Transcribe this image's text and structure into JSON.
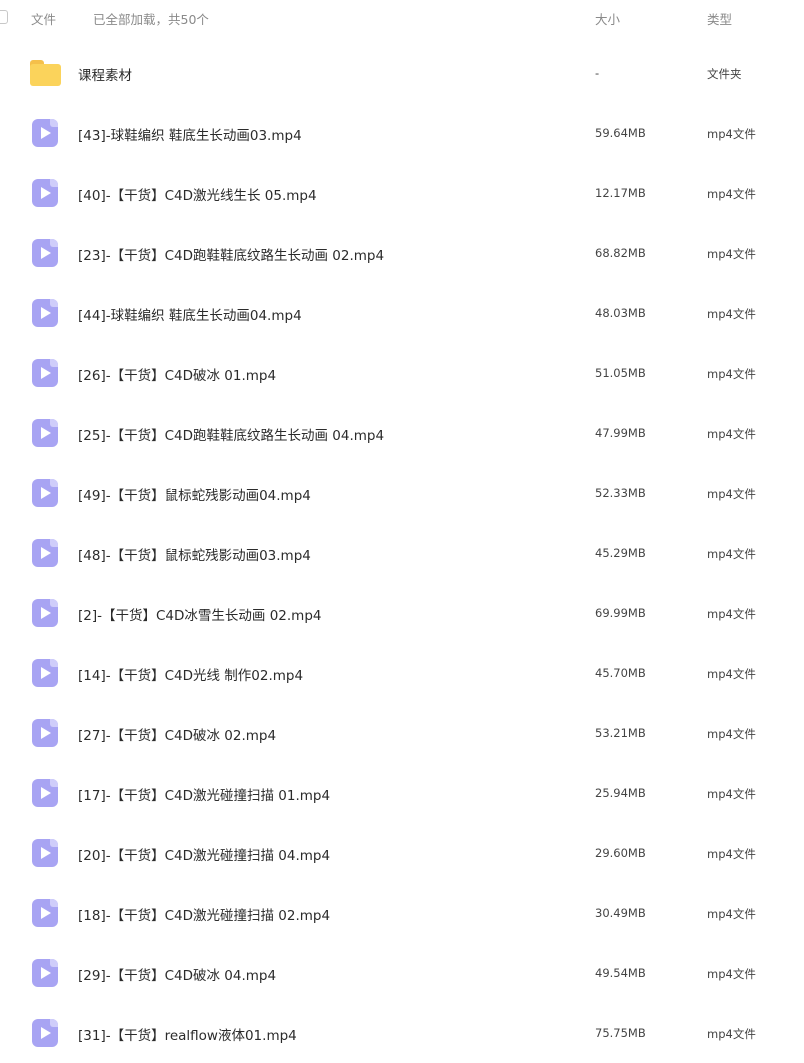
{
  "header": {
    "col_file": "文件",
    "status": "已全部加载，共50个",
    "col_size": "大小",
    "col_type": "类型"
  },
  "files": [
    {
      "name": "课程素材",
      "size": "-",
      "type": "文件夹",
      "icon": "folder-icon"
    },
    {
      "name": "[43]-球鞋编织 鞋底生长动画03.mp4",
      "size": "59.64MB",
      "type": "mp4文件",
      "icon": "video-file-icon"
    },
    {
      "name": "[40]-【干货】C4D激光线生长 05.mp4",
      "size": "12.17MB",
      "type": "mp4文件",
      "icon": "video-file-icon"
    },
    {
      "name": "[23]-【干货】C4D跑鞋鞋底纹路生长动画 02.mp4",
      "size": "68.82MB",
      "type": "mp4文件",
      "icon": "video-file-icon"
    },
    {
      "name": "[44]-球鞋编织 鞋底生长动画04.mp4",
      "size": "48.03MB",
      "type": "mp4文件",
      "icon": "video-file-icon"
    },
    {
      "name": "[26]-【干货】C4D破冰 01.mp4",
      "size": "51.05MB",
      "type": "mp4文件",
      "icon": "video-file-icon"
    },
    {
      "name": "[25]-【干货】C4D跑鞋鞋底纹路生长动画 04.mp4",
      "size": "47.99MB",
      "type": "mp4文件",
      "icon": "video-file-icon"
    },
    {
      "name": "[49]-【干货】鼠标蛇残影动画04.mp4",
      "size": "52.33MB",
      "type": "mp4文件",
      "icon": "video-file-icon"
    },
    {
      "name": "[48]-【干货】鼠标蛇残影动画03.mp4",
      "size": "45.29MB",
      "type": "mp4文件",
      "icon": "video-file-icon"
    },
    {
      "name": "[2]-【干货】C4D冰雪生长动画 02.mp4",
      "size": "69.99MB",
      "type": "mp4文件",
      "icon": "video-file-icon"
    },
    {
      "name": "[14]-【干货】C4D光线 制作02.mp4",
      "size": "45.70MB",
      "type": "mp4文件",
      "icon": "video-file-icon"
    },
    {
      "name": "[27]-【干货】C4D破冰 02.mp4",
      "size": "53.21MB",
      "type": "mp4文件",
      "icon": "video-file-icon"
    },
    {
      "name": "[17]-【干货】C4D激光碰撞扫描 01.mp4",
      "size": "25.94MB",
      "type": "mp4文件",
      "icon": "video-file-icon"
    },
    {
      "name": "[20]-【干货】C4D激光碰撞扫描 04.mp4",
      "size": "29.60MB",
      "type": "mp4文件",
      "icon": "video-file-icon"
    },
    {
      "name": "[18]-【干货】C4D激光碰撞扫描 02.mp4",
      "size": "30.49MB",
      "type": "mp4文件",
      "icon": "video-file-icon"
    },
    {
      "name": "[29]-【干货】C4D破冰 04.mp4",
      "size": "49.54MB",
      "type": "mp4文件",
      "icon": "video-file-icon"
    },
    {
      "name": "[31]-【干货】realflow液体01.mp4",
      "size": "75.75MB",
      "type": "mp4文件",
      "icon": "video-file-icon"
    }
  ]
}
